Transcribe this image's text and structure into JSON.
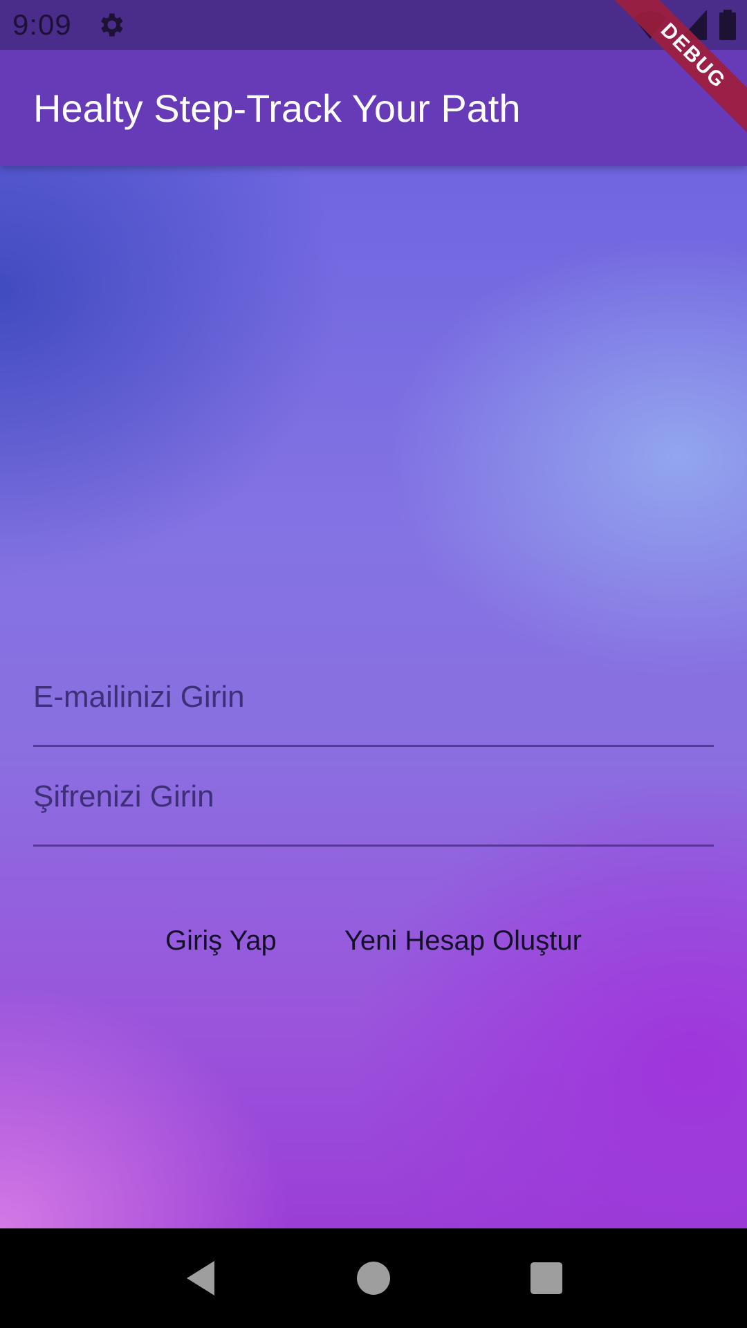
{
  "status_bar": {
    "time": "9:09",
    "icons": [
      "gear-icon",
      "wifi-icon",
      "signal-icon",
      "battery-icon"
    ]
  },
  "app_bar": {
    "title": "Healty Step-Track Your Path",
    "color": "#673ab7"
  },
  "debug_banner": {
    "label": "DEBUG"
  },
  "login_form": {
    "email_placeholder": "E-mailinizi Girin",
    "password_placeholder": "Şifrenizi Girin",
    "login_label": "Giriş Yap",
    "register_label": "Yeni Hesap Oluştur"
  },
  "nav_bar": {
    "icons": [
      "back-icon",
      "home-icon",
      "recents-icon"
    ]
  }
}
